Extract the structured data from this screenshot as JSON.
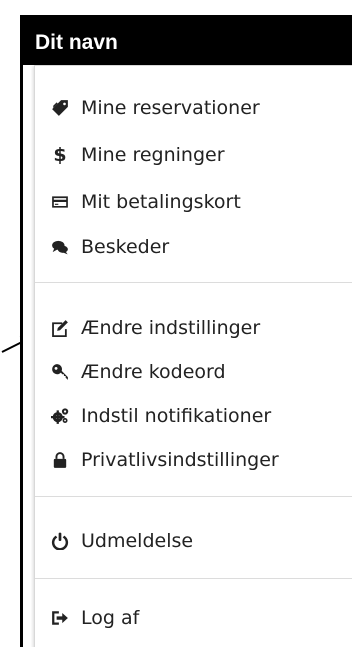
{
  "header": {
    "title": "Dit navn"
  },
  "menu": {
    "items": [
      {
        "label": "Mine reservationer",
        "icon": "tag-icon"
      },
      {
        "label": "Mine regninger",
        "icon": "dollar-icon"
      },
      {
        "label": "Mit betalingskort",
        "icon": "credit-card-icon"
      },
      {
        "label": "Beskeder",
        "icon": "comments-icon"
      },
      {
        "label": "Ændre indstillinger",
        "icon": "edit-icon"
      },
      {
        "label": "Ændre kodeord",
        "icon": "key-icon"
      },
      {
        "label": "Indstil notifikationer",
        "icon": "cogs-icon"
      },
      {
        "label": "Privatlivsindstillinger",
        "icon": "lock-icon"
      },
      {
        "label": "Udmeldelse",
        "icon": "power-icon"
      },
      {
        "label": "Log af",
        "icon": "sign-out-icon"
      }
    ],
    "dollar_glyph": "$"
  }
}
